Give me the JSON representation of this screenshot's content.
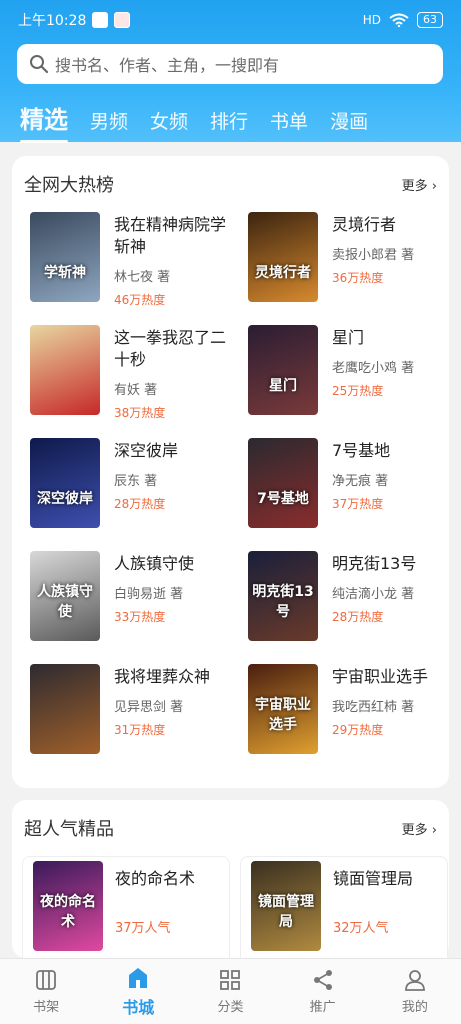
{
  "status": {
    "time": "上午10:28",
    "network": "HD",
    "battery": "63"
  },
  "search": {
    "placeholder": "搜书名、作者、主角，一搜即有"
  },
  "tabs": [
    "精选",
    "男频",
    "女频",
    "排行",
    "书单",
    "漫画"
  ],
  "hot": {
    "title": "全网大热榜",
    "more": "更多",
    "books": [
      {
        "title": "我在精神病院学斩神",
        "author": "林七夜 著",
        "heat": "46万热度",
        "cover_text": "学斩神",
        "color1": "#3a4a5e",
        "color2": "#8ea6c0"
      },
      {
        "title": "灵境行者",
        "author": "卖报小郎君 著",
        "heat": "36万热度",
        "cover_text": "灵境行者",
        "color1": "#3b2410",
        "color2": "#d88a2e"
      },
      {
        "title": "这一拳我忍了二十秒",
        "author": "有妖 著",
        "heat": "38万热度",
        "cover_text": "",
        "color1": "#e8d6a0",
        "color2": "#c62828"
      },
      {
        "title": "星门",
        "author": "老鹰吃小鸡 著",
        "heat": "25万热度",
        "cover_text": "星门",
        "color1": "#2a1d33",
        "color2": "#7a3a3a"
      },
      {
        "title": "深空彼岸",
        "author": "辰东 著",
        "heat": "28万热度",
        "cover_text": "深空彼岸",
        "color1": "#0e1a4a",
        "color2": "#3f4fb0"
      },
      {
        "title": "7号基地",
        "author": "净无痕 著",
        "heat": "37万热度",
        "cover_text": "7号基地",
        "color1": "#2a2a30",
        "color2": "#8a2c2c"
      },
      {
        "title": "人族镇守使",
        "author": "白驹易逝 著",
        "heat": "33万热度",
        "cover_text": "人族镇守使",
        "color1": "#d8d8d8",
        "color2": "#5a5a5a"
      },
      {
        "title": "明克街13号",
        "author": "纯洁滴小龙 著",
        "heat": "28万热度",
        "cover_text": "明克街13号",
        "color1": "#1a1f3a",
        "color2": "#6a3a2a"
      },
      {
        "title": "我将埋葬众神",
        "author": "见异思剑 著",
        "heat": "31万热度",
        "cover_text": "",
        "color1": "#2e2a30",
        "color2": "#a0602a"
      },
      {
        "title": "宇宙职业选手",
        "author": "我吃西红柿 著",
        "heat": "29万热度",
        "cover_text": "宇宙职业选手",
        "color1": "#4a1e10",
        "color2": "#e0a030"
      }
    ]
  },
  "premium": {
    "title": "超人气精品",
    "more": "更多",
    "books": [
      {
        "title": "夜的命名术",
        "popularity": "37万人气",
        "cover_text": "夜的命名术",
        "color1": "#3a1a5a",
        "color2": "#e04aa0"
      },
      {
        "title": "镜面管理局",
        "popularity": "32万人气",
        "cover_text": "镜面管理局",
        "color1": "#3a3020",
        "color2": "#b08a40"
      }
    ]
  },
  "nav": [
    {
      "label": "书架",
      "icon": "bookshelf-icon"
    },
    {
      "label": "书城",
      "icon": "bookstore-icon"
    },
    {
      "label": "分类",
      "icon": "category-icon"
    },
    {
      "label": "推广",
      "icon": "share-icon"
    },
    {
      "label": "我的",
      "icon": "profile-icon"
    }
  ],
  "colors": {
    "accent": "#2b9be8",
    "heat": "#f06a3d",
    "header": "#21a2f0"
  }
}
